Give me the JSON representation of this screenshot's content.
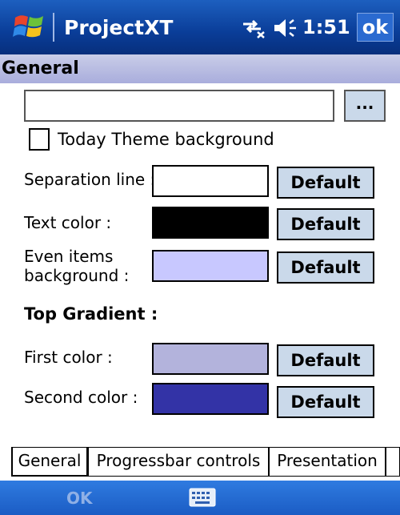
{
  "titlebar": {
    "app_title": "ProjectXT",
    "clock": "1:51",
    "ok_label": "ok"
  },
  "section": {
    "header": "General"
  },
  "path": {
    "value": "",
    "browse_label": "..."
  },
  "today_theme": {
    "label": "Today Theme background",
    "checked": false
  },
  "rows": {
    "separation": {
      "label": "Separation line :",
      "color": "#ffffff",
      "button": "Default"
    },
    "text": {
      "label": "Text color :",
      "color": "#000000",
      "button": "Default"
    },
    "even": {
      "label_line1": "Even items",
      "label_line2": "background :",
      "color": "#c8c8ff",
      "button": "Default"
    }
  },
  "gradient": {
    "heading": "Top Gradient :",
    "first": {
      "label": "First color :",
      "color": "#b3b3dc",
      "button": "Default"
    },
    "second": {
      "label": "Second color :",
      "color": "#3333a6",
      "button": "Default"
    }
  },
  "tabs": {
    "general": "General",
    "progressbar": "Progressbar controls",
    "presentation": "Presentation"
  },
  "bottombar": {
    "ok_label": "OK"
  },
  "colors": {
    "title_bar": "#0a3d98",
    "section_header": "#a9addc",
    "button_fill": "#cad9ea",
    "bottom_bar": "#1b5cc4"
  },
  "icons": [
    "windows-start-icon",
    "connectivity-icon",
    "volume-icon",
    "keyboard-icon"
  ]
}
